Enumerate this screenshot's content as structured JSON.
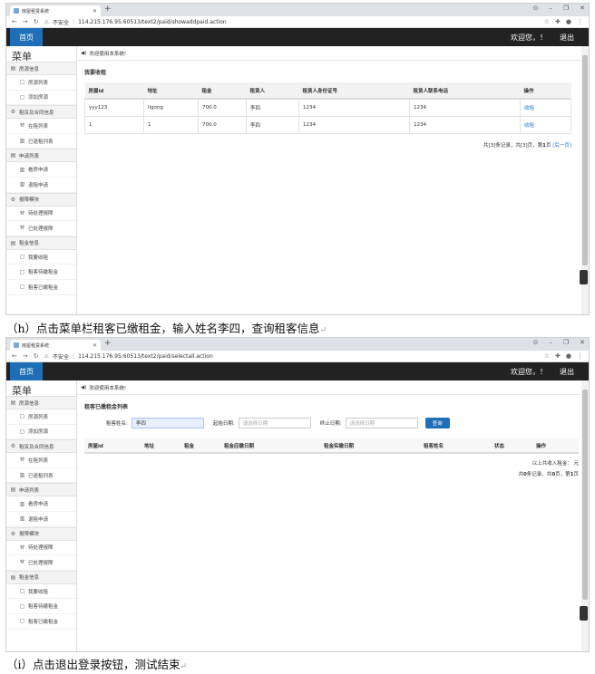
{
  "browser": {
    "tab_title": "房屋租赁系统",
    "not_secure": "不安全",
    "url1": "114.215.176.95:60513/text2/paid/showaddpaid.action",
    "url2": "114.215.176.95:60513/text2/paid/selectall.action"
  },
  "app": {
    "home": "首页",
    "greeting": "欢迎您，！",
    "logout": "退出",
    "welcome": "欢迎使用本系统!"
  },
  "sidebar": {
    "title": "菜单",
    "sections": [
      {
        "label": "房源信息",
        "items": [
          "房源列表",
          "添加房源"
        ]
      },
      {
        "label": "租赁及合同信息",
        "items": [
          "在租列表",
          "已退租列表"
        ]
      },
      {
        "label": "申请列表",
        "items": [
          "看房申请",
          "退租申请"
        ]
      },
      {
        "label": "报障模块",
        "items": [
          "待处理报障",
          "已处理报障"
        ]
      },
      {
        "label": "租金信息",
        "items": [
          "我要收租",
          "租客待缴租金",
          "租客已缴租金"
        ]
      }
    ]
  },
  "screen1": {
    "page_title": "我要收租",
    "columns": [
      "房屋id",
      "地址",
      "租金",
      "租赁人",
      "租赁人身份证号",
      "租赁人联系电话",
      "操作"
    ],
    "rows": [
      [
        "yyy123",
        "ligong",
        "700.0",
        "李四",
        "1234",
        "1234",
        "收租"
      ],
      [
        "1",
        "1",
        "700.0",
        "李四",
        "1234",
        "1234",
        "收租"
      ]
    ],
    "pager_prefix": "共[3]条记录，共[3]页，第",
    "pager_page": "1",
    "pager_mid": "页 ",
    "pager_next": "[后一页]"
  },
  "caption1": "（h）点击菜单栏租客已缴租金，输入姓名李四，查询租客信息",
  "screen2": {
    "page_title": "租客已缴租金列表",
    "name_label": "租客姓名:",
    "name_value": "李四",
    "start_label": "起始日期:",
    "start_placeholder": "请选择日期",
    "end_label": "终止日期:",
    "end_placeholder": "请选择日期",
    "query_button": "查询",
    "columns": [
      "房屋id",
      "地址",
      "租金",
      "租金应缴日期",
      "租金实缴日期",
      "租客姓名",
      "状态",
      "操作"
    ],
    "summary": "以上共收入租金：  元",
    "pager_prefix": "共",
    "pager_count": "0",
    "pager_mid": "条记录，共",
    "pager_pages": "0",
    "pager_suffix": "页，第",
    "pager_page": "1",
    "pager_end": "页"
  },
  "caption2": "（i）点击退出登录按钮，测试结束",
  "return_mark": "↵"
}
